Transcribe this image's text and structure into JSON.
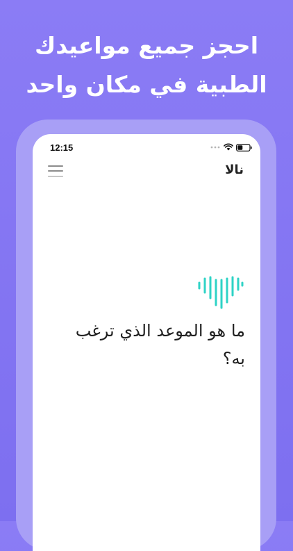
{
  "headline": {
    "line1": "احجز جميع مواعيدك",
    "line2": "الطبية في مكان واحد"
  },
  "status_bar": {
    "time": "12:15"
  },
  "app_bar": {
    "title": "نالا"
  },
  "assistant": {
    "prompt": "ما هو الموعد الذي ترغب به؟"
  },
  "icons": [
    "signal-icon",
    "wifi-icon",
    "battery-icon",
    "hamburger-menu-icon",
    "voice-wave-logo-icon"
  ],
  "colors": {
    "background": "#8b7cf5",
    "phone_frame": "#a89ff6",
    "logo_accent": "#2ed3c6"
  }
}
